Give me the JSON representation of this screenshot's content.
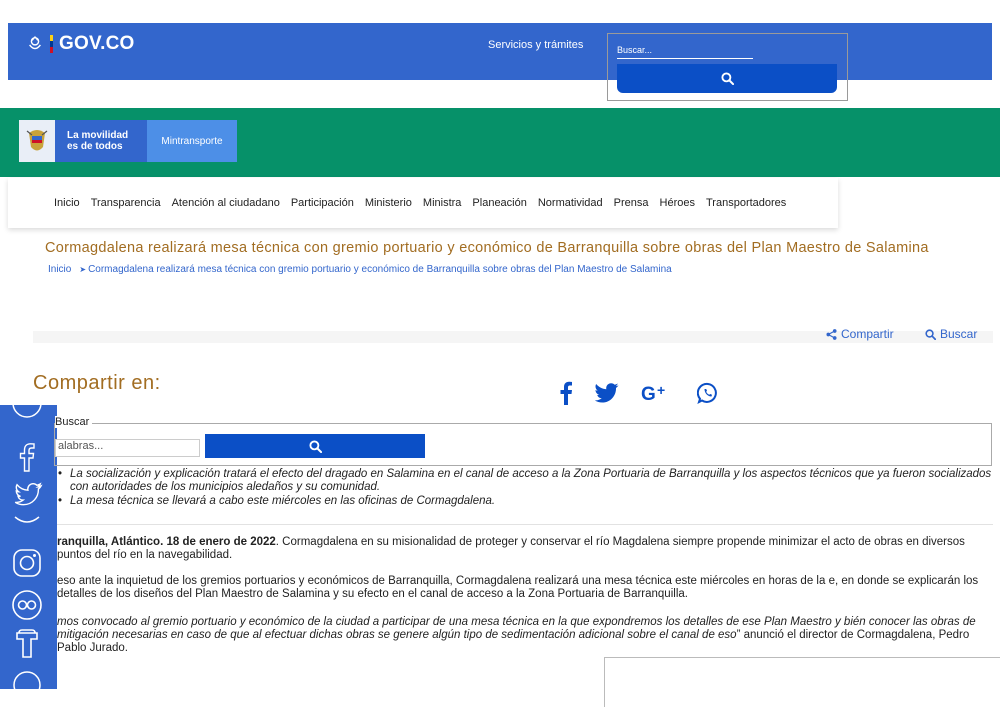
{
  "header": {
    "logo_text": "GOV.CO",
    "services_link": "Servicios y trámites",
    "search_placeholder": "Buscar..."
  },
  "brand": {
    "motto_line1": "La movilidad",
    "motto_line2": "es de todos",
    "ministry_tab": "Mintransporte"
  },
  "nav": {
    "items": [
      "Inicio",
      "Transparencia",
      "Atención al ciudadano",
      "Participación",
      "Ministerio",
      "Ministra",
      "Planeación",
      "Normatividad",
      "Prensa",
      "Héroes",
      "Transportadores"
    ]
  },
  "article": {
    "title": "Cormagdalena realizará mesa técnica con gremio portuario y económico de Barranquilla sobre obras del Plan Maestro de Salamina",
    "breadcrumb_home": "Inicio",
    "breadcrumb_current": "Cormagdalena realizará mesa técnica con gremio portuario y económico de Barranquilla sobre obras del Plan Maestro de Salamina"
  },
  "actions": {
    "share_label": "Compartir",
    "search_label": "Buscar"
  },
  "share": {
    "title": "Compartir en:"
  },
  "search_panel": {
    "legend": "Buscar",
    "placeholder": "alabras..."
  },
  "bullets": [
    "La socialización y explicación tratará el efecto del dragado en Salamina en el canal de acceso a la Zona Portuaria de Barranquilla y los aspectos técnicos que ya fueron socializados con autoridades de los municipios aledaños y su comunidad.",
    "La mesa técnica se llevará a cabo este miércoles en las oficinas de Cormagdalena."
  ],
  "paragraphs": {
    "p1_bold": "ranquilla, Atlántico. 18 de enero de 2022",
    "p1_text": ". Cormagdalena en su misionalidad de proteger y conservar el río Magdalena siempre propende minimizar el acto de obras en diversos puntos del río en la navegabilidad.",
    "p2_text": "eso ante la inquietud de los gremios portuarios y económicos de Barranquilla, Cormagdalena realizará una mesa técnica este miércoles en horas de la e, en donde se explicarán los detalles de los diseños del Plan Maestro de Salamina y su efecto en el canal de acceso a la Zona Portuaria de Barranquilla.",
    "p3_italic": "mos convocado al gremio portuario y económico de la ciudad a participar de una mesa técnica en la que expondremos los detalles de ese Plan Maestro y bién conocer las obras de mitigación necesarias en caso de que al efectuar dichas obras se genere algún tipo de sedimentación adicional sobre el canal de eso",
    "p3_text": "” anunció el director de Cormagdalena, Pedro Pablo Jurado."
  },
  "colors": {
    "gov_blue": "#3366cc",
    "green": "#069169",
    "title_gold": "#a26d22"
  }
}
